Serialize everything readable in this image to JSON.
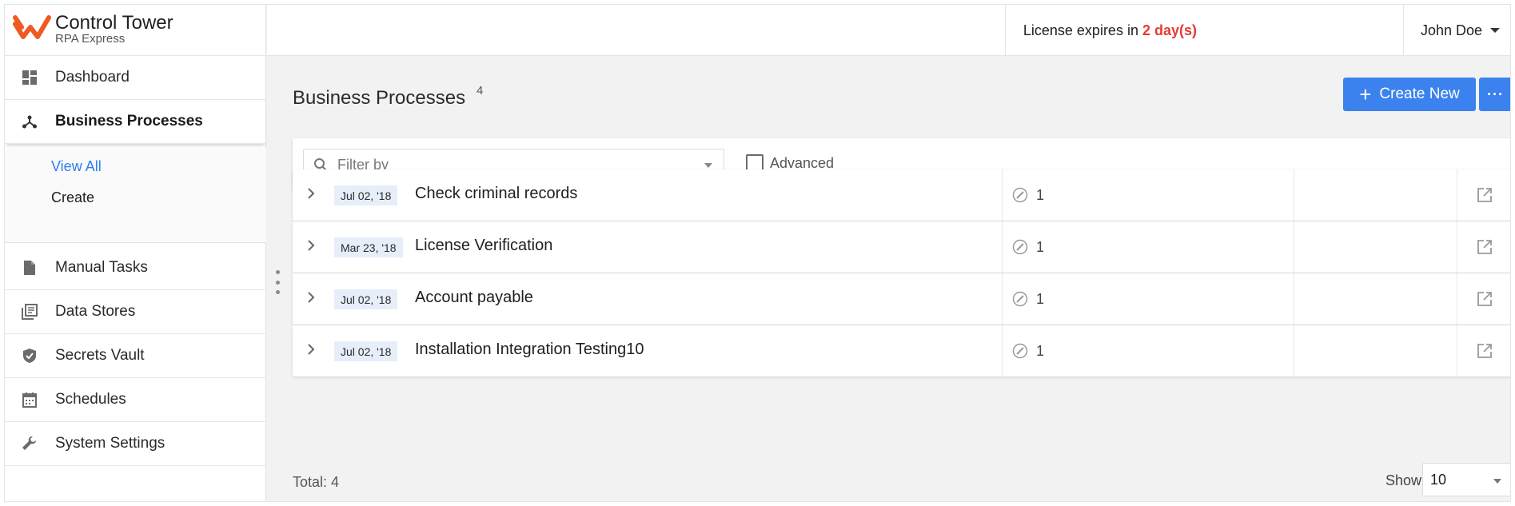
{
  "brand": {
    "title": "Control Tower",
    "subtitle": "RPA Express",
    "logo_icon": "workfusion-logo-icon",
    "logo_color": "#ef5a24"
  },
  "sidebar": {
    "items": [
      {
        "label": "Dashboard",
        "icon": "dashboard-icon"
      },
      {
        "label": "Business Processes",
        "icon": "process-icon",
        "active": true
      },
      {
        "label": "Manual Tasks",
        "icon": "document-icon"
      },
      {
        "label": "Data Stores",
        "icon": "library-icon"
      },
      {
        "label": "Secrets Vault",
        "icon": "shield-check-icon"
      },
      {
        "label": "Schedules",
        "icon": "calendar-icon"
      },
      {
        "label": "System Settings",
        "icon": "wrench-icon"
      }
    ],
    "subitems": [
      {
        "label": "View All",
        "active": true
      },
      {
        "label": "Create"
      }
    ]
  },
  "header": {
    "license_prefix": "License expires in",
    "license_days": "2 day(s)",
    "user_name": "John Doe"
  },
  "main": {
    "title": "Business Processes",
    "count": "4",
    "create_label": "Create New",
    "more_label": "···",
    "filter_placeholder": "Filter by",
    "advanced_label": "Advanced",
    "processes": [
      {
        "date": "Jul 02, '18",
        "name": "Check criminal records",
        "count": "1"
      },
      {
        "date": "Mar 23, '18",
        "name": "License Verification",
        "count": "1"
      },
      {
        "date": "Jul 02, '18",
        "name": "Account payable",
        "count": "1"
      },
      {
        "date": "Jul 02, '18",
        "name": "Installation Integration Testing10",
        "count": "1"
      }
    ],
    "total_label": "Total: 4",
    "show_label": "Show",
    "page_size": "10"
  },
  "colors": {
    "accent": "#3b82ee",
    "link": "#2d7ff0",
    "danger": "#e53935"
  }
}
